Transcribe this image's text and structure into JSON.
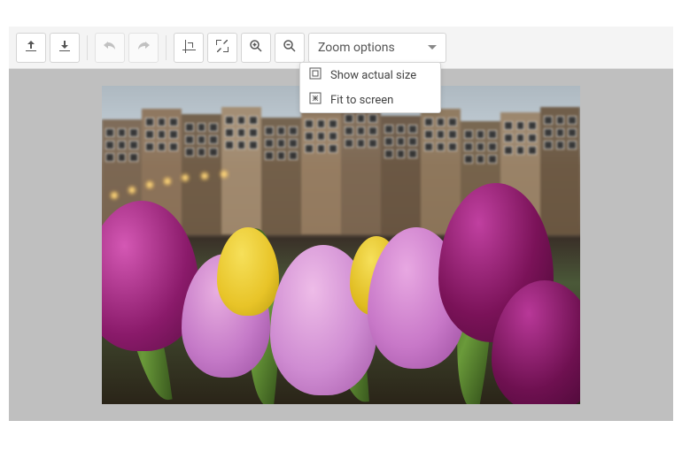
{
  "toolbar": {
    "upload_tooltip": "Open",
    "download_tooltip": "Save",
    "undo_tooltip": "Undo",
    "redo_tooltip": "Redo",
    "crop_tooltip": "Crop",
    "resize_tooltip": "Resize",
    "zoom_in_tooltip": "Zoom in",
    "zoom_out_tooltip": "Zoom out"
  },
  "zoom_dropdown": {
    "label": "Zoom options",
    "items": [
      {
        "label": "Show actual size"
      },
      {
        "label": "Fit to screen"
      }
    ]
  },
  "image": {
    "description": "Tulips in foreground with Amsterdam canal houses"
  }
}
